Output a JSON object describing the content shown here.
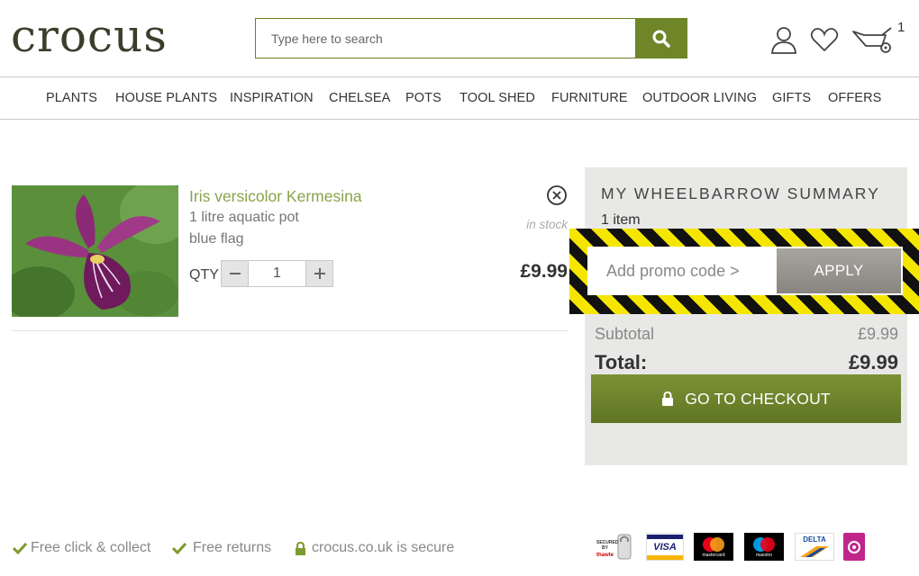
{
  "header": {
    "logo": "crocus",
    "search_placeholder": "Type here to search",
    "cart_count": "1",
    "icons": [
      "account-icon",
      "wishlist-heart-icon",
      "wheelbarrow-cart-icon",
      "search-icon"
    ]
  },
  "nav": {
    "items": [
      "PLANTS",
      "HOUSE PLANTS",
      "INSPIRATION",
      "CHELSEA",
      "POTS",
      "TOOL SHED",
      "FURNITURE",
      "OUTDOOR LIVING",
      "GIFTS",
      "OFFERS"
    ]
  },
  "basket": {
    "item": {
      "name": "Iris versicolor Kermesina",
      "size": "1 litre aquatic pot",
      "common_name": "blue flag",
      "qty_label": "QTY",
      "qty": "1",
      "stock": "in stock",
      "price": "£9.99"
    }
  },
  "summary": {
    "title": "MY WHEELBARROW SUMMARY",
    "item_count": "1 item",
    "promo_placeholder": "Add promo code >",
    "apply_label": "APPLY",
    "subtotal_label": "Subtotal",
    "subtotal_value": "£9.99",
    "total_label": "Total:",
    "total_value": "£9.99",
    "checkout_label": "GO TO CHECKOUT"
  },
  "footer": {
    "trust": [
      "Free click & collect",
      "Free returns",
      "crocus.co.uk is secure"
    ],
    "payments": [
      "VISA",
      "mastercard",
      "maestro",
      "DELTA"
    ]
  },
  "colors": {
    "brand_green": "#6e8528",
    "product_link": "#8aa24a",
    "summary_bg": "#e8e8e6",
    "hazard_yellow": "#f5e600"
  }
}
